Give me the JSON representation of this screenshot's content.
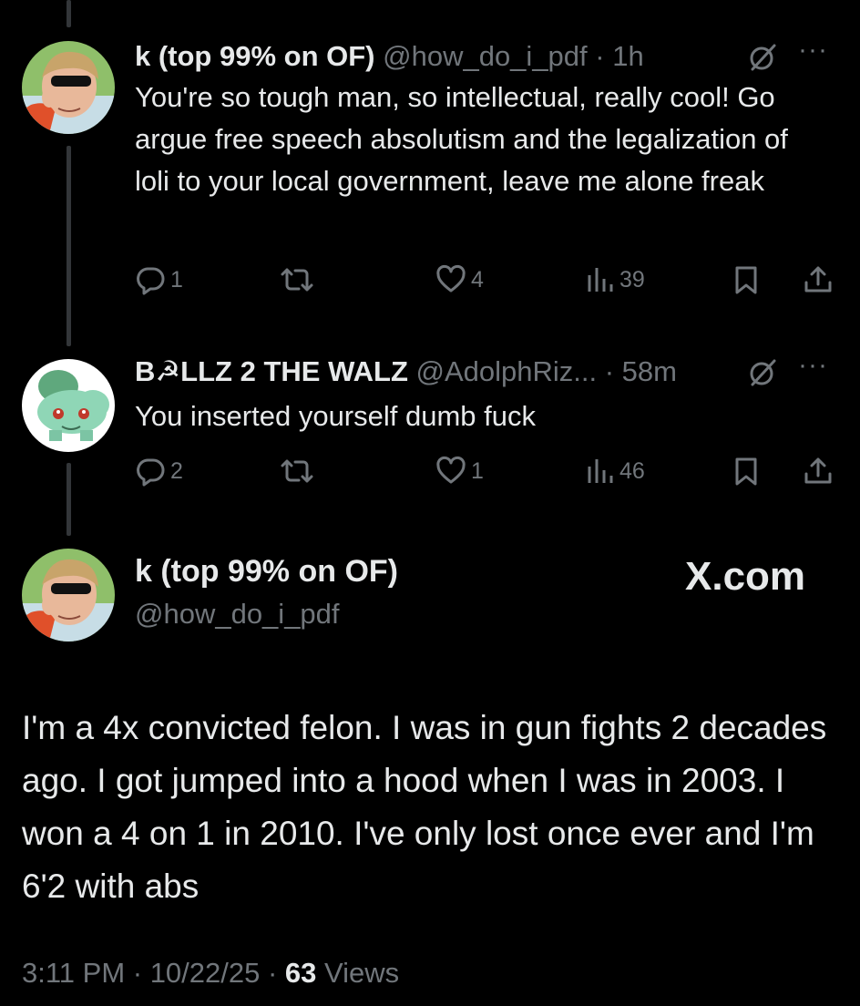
{
  "replies": [
    {
      "name": "k (top 99% on OF)",
      "handle": "@how_do_i_pdf",
      "separator": " · ",
      "time": "1h",
      "text": "You're so tough man, so intellectual, really cool! Go argue free speech absolutism and the legalization of loli to your local government, leave me alone freak",
      "replies_count": "1",
      "likes_count": "4",
      "views_count": "39"
    },
    {
      "name": "B☭LLZ 2 THE WALZ",
      "handle": "@AdolphRiz...",
      "separator": " · ",
      "time": "58m",
      "text": "You inserted yourself dumb fuck",
      "replies_count": "2",
      "likes_count": "1",
      "views_count": "46"
    }
  ],
  "main": {
    "name": "k (top 99% on OF)",
    "handle": "@how_do_i_pdf",
    "site": "X.com",
    "text": "I'm a 4x convicted felon. I was in gun fights 2 decades ago. I got jumped into a hood when I was in 2003. I won a 4 on 1 in 2010. I've only lost once ever and I'm 6'2 with abs",
    "timestamp": "3:11 PM · 10/22/25 · ",
    "views_count": "63",
    "views_label": " Views"
  },
  "icons": {
    "more": "more-dots-icon",
    "grok": "grok-icon",
    "reply": "reply-icon",
    "retweet": "retweet-icon",
    "like": "heart-icon",
    "views": "views-bars-icon",
    "bookmark": "bookmark-icon",
    "share": "share-icon"
  },
  "colors": {
    "background": "#000000",
    "text": "#e7e9ea",
    "muted": "#71767b",
    "thread_line": "#333639"
  }
}
